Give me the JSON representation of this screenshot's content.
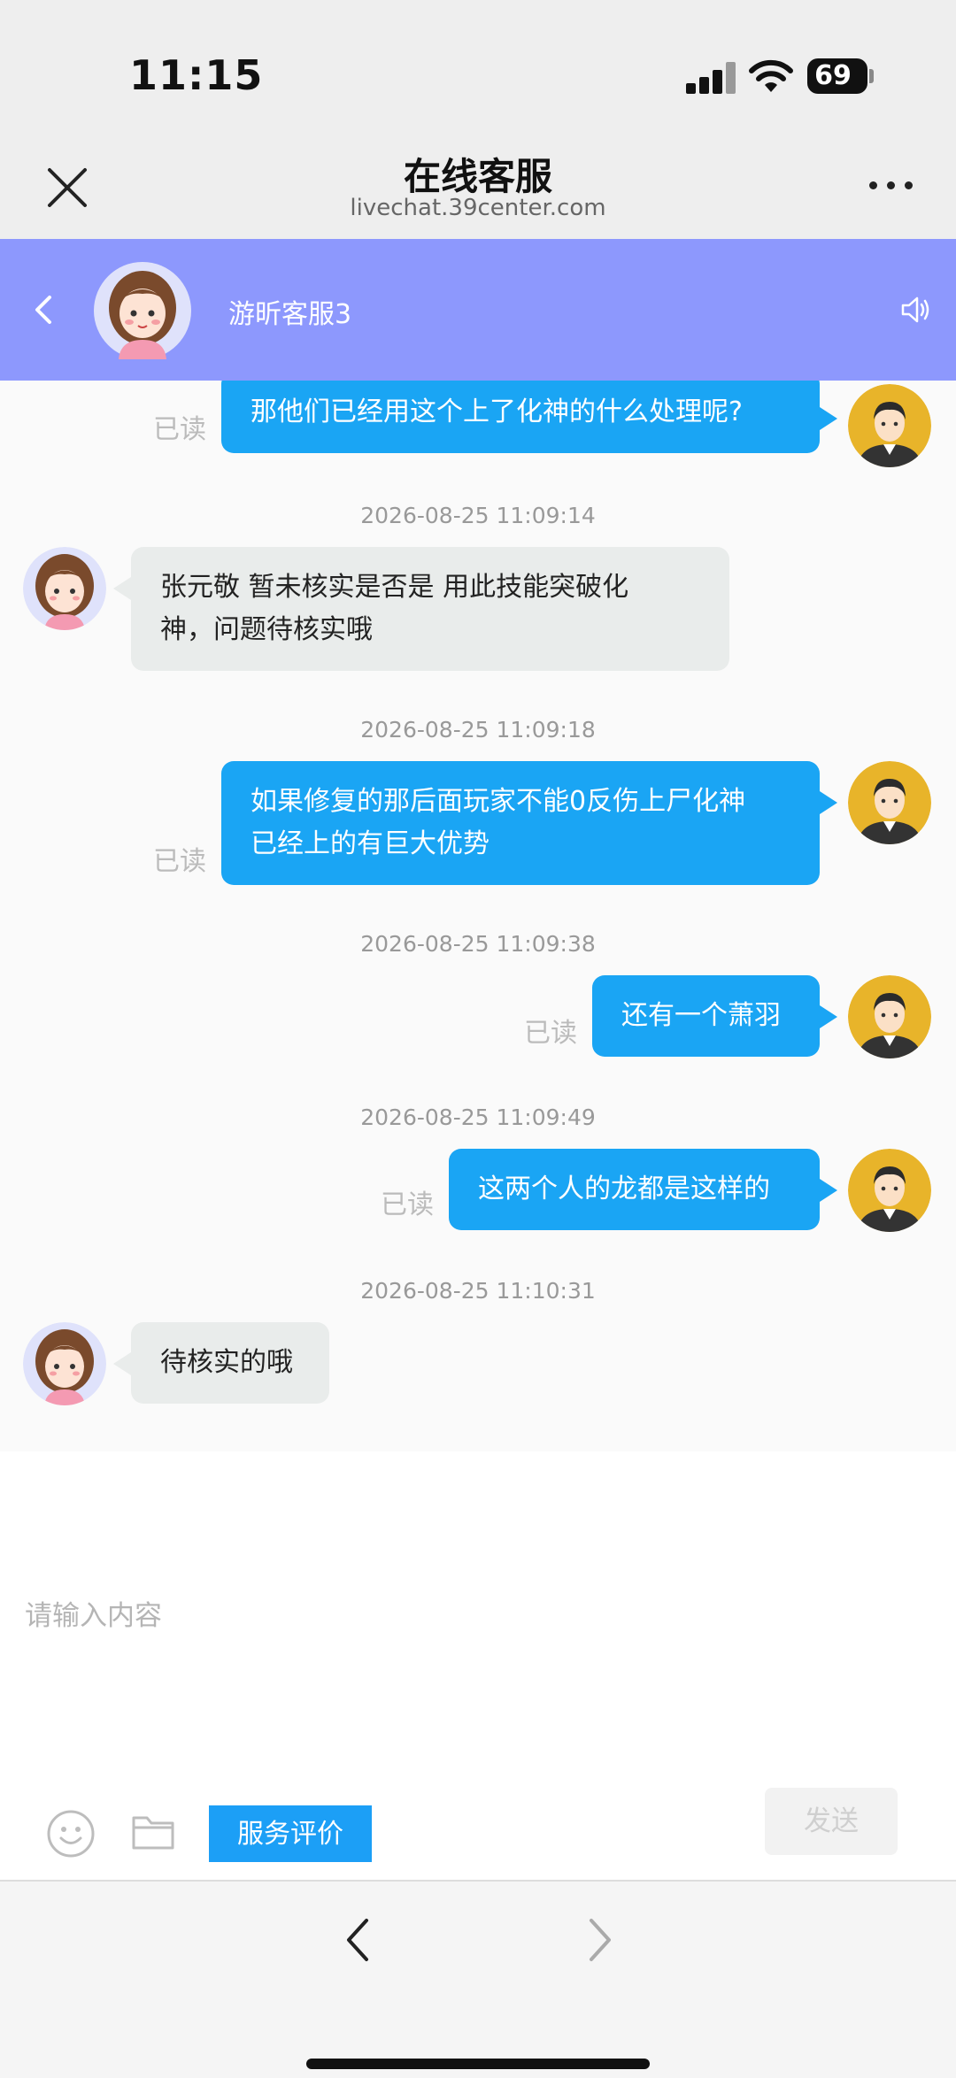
{
  "status_bar": {
    "time": "11:15",
    "battery": "69"
  },
  "browser": {
    "title": "在线客服",
    "url": "livechat.39center.com",
    "close_icon": "close-icon",
    "more_icon": "more-horizontal-icon"
  },
  "chat_header": {
    "agent_name": "游昕客服3",
    "back_icon": "chevron-left-icon",
    "speaker_icon": "speaker-icon"
  },
  "messages": [
    {
      "side": "out",
      "text": "那他们已经用这个上了化神的什么处理呢?",
      "status": "已读"
    },
    {
      "timestamp": "2026-08-25 11:09:14",
      "side": "in",
      "lines": [
        "张元敬 暂未核实是否是 用此技能突破化",
        "神，问题待核实哦"
      ]
    },
    {
      "timestamp": "2026-08-25 11:09:18",
      "side": "out",
      "lines": [
        "如果修复的那后面玩家不能0反伤上尸化神",
        "已经上的有巨大优势"
      ],
      "status": "已读"
    },
    {
      "timestamp": "2026-08-25 11:09:38",
      "side": "out",
      "text": "还有一个萧羽",
      "status": "已读"
    },
    {
      "timestamp": "2026-08-25 11:09:49",
      "side": "out",
      "text": "这两个人的龙都是这样的",
      "status": "已读"
    },
    {
      "timestamp": "2026-08-25 11:10:31",
      "side": "in",
      "text": "待核实的哦"
    }
  ],
  "input": {
    "placeholder": "请输入内容",
    "rate_button": "服务评价",
    "send_button": "发送",
    "emoji_icon": "emoji-icon",
    "folder_icon": "folder-icon"
  },
  "bottom_nav": {
    "back_icon": "chevron-left-icon",
    "forward_icon": "chevron-right-icon"
  },
  "colors": {
    "chat_header_bg": "#8d98fd",
    "outgoing_bubble": "#1aa5f4",
    "incoming_bubble": "#e9eceb",
    "rate_button": "#1c9ff6"
  }
}
